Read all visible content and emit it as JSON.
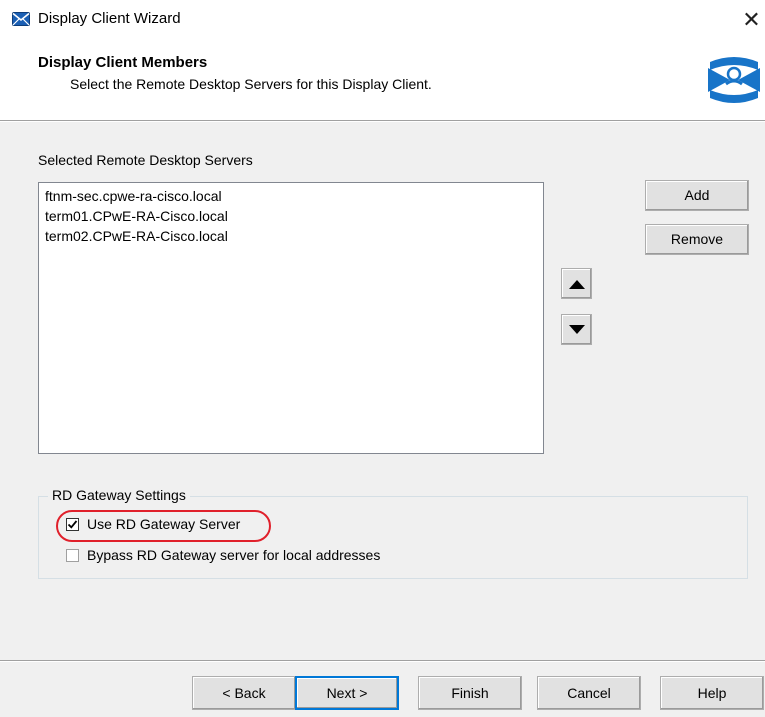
{
  "window": {
    "title": "Display Client Wizard",
    "close_symbol": "✕",
    "icon": "envelope-app-icon"
  },
  "header": {
    "title": "Display Client Members",
    "subtitle": "Select the Remote Desktop Servers for this Display Client.",
    "logo": "thinmanager-logo-icon"
  },
  "servers": {
    "label": "Selected Remote Desktop Servers",
    "items": [
      "ftnm-sec.cpwe-ra-cisco.local",
      "term01.CPwE-RA-Cisco.local",
      "term02.CPwE-RA-Cisco.local"
    ]
  },
  "side_buttons": {
    "add": "Add",
    "remove": "Remove",
    "up_icon": "arrow-up-icon",
    "down_icon": "arrow-down-icon"
  },
  "gateway": {
    "legend": "RD Gateway Settings",
    "use_gateway": {
      "label": "Use RD Gateway Server",
      "checked": true
    },
    "bypass_local": {
      "label": "Bypass RD Gateway server for local addresses",
      "checked": false
    }
  },
  "footer": {
    "back": "< Back",
    "next": "Next >",
    "finish": "Finish",
    "cancel": "Cancel",
    "help": "Help"
  },
  "colors": {
    "highlight": "#e0202b",
    "logo_blue": "#1874c8",
    "default_button_border": "#0078d7"
  }
}
